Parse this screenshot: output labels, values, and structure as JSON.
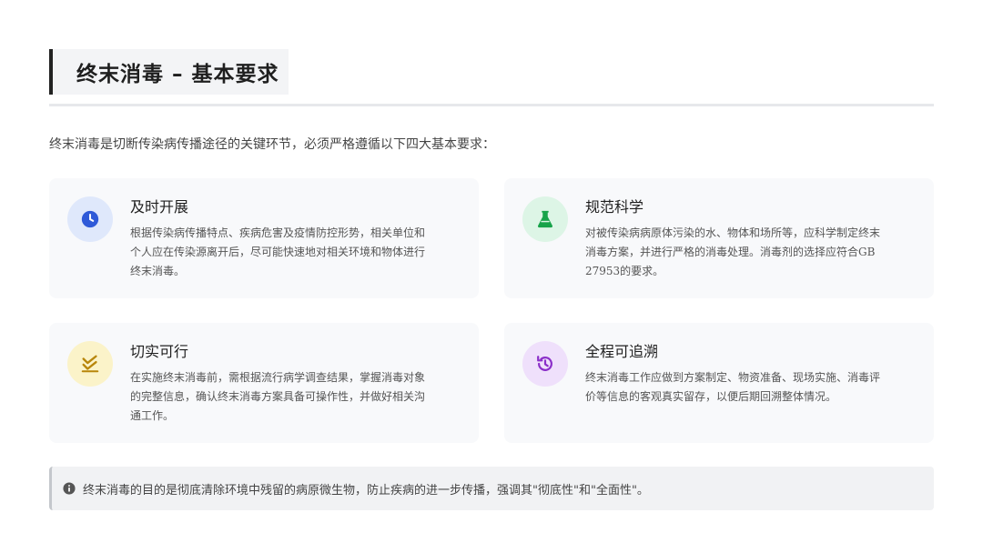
{
  "header": {
    "title": "终末消毒 – 基本要求"
  },
  "intro": "终末消毒是切断传染病传播途径的关键环节，必须严格遵循以下四大基本要求：",
  "cards": [
    {
      "title": "及时开展",
      "icon": "clock-icon",
      "color": "#2f5ad8",
      "bg": "#dfe8fb",
      "body": [
        "根据传染病传播特点、疾病危害及疫情防控形势，相关单位和",
        "个人应在传染源离开后，尽可能快速地对相关环境和物体进行",
        "终末消毒。"
      ]
    },
    {
      "title": "规范科学",
      "icon": "flask-icon",
      "color": "#17a34a",
      "bg": "#ddf5e6",
      "body": [
        "对被传染病病原体污染的水、物体和场所等，应科学制定终末",
        "消毒方案，并进行严格的消毒处理。消毒剂的选择应符合GB",
        "27953的要求。"
      ]
    },
    {
      "title": "切实可行",
      "icon": "double-check-icon",
      "color": "#b8860b",
      "bg": "#fbf3c9",
      "body": [
        "在实施终末消毒前，需根据流行病学调查结果，掌握消毒对象",
        "的完整信息，确认终末消毒方案具备可操作性，并做好相关沟",
        "通工作。"
      ]
    },
    {
      "title": "全程可追溯",
      "icon": "history-icon",
      "color": "#8b2fc9",
      "bg": "#efe0fb",
      "body": [
        "终末消毒工作应做到方案制定、物资准备、现场实施、消毒评",
        "价等信息的客观真实留存，以便后期回溯整体情况。"
      ]
    }
  ],
  "note": {
    "icon": "info-icon",
    "text": "终末消毒的目的是彻底清除环境中残留的病原微生物，防止疾病的进一步传播，强调其\"彻底性\"和\"全面性\"。"
  }
}
